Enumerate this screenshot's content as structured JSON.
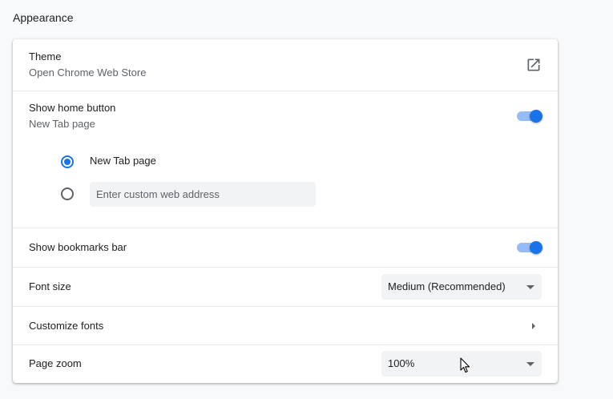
{
  "section": {
    "title": "Appearance"
  },
  "theme": {
    "label": "Theme",
    "sublabel": "Open Chrome Web Store",
    "icon": "open-in-new-icon"
  },
  "home_button": {
    "label": "Show home button",
    "sublabel": "New Tab page",
    "enabled": true,
    "options": [
      {
        "label": "New Tab page",
        "selected": true
      },
      {
        "label": "",
        "placeholder": "Enter custom web address",
        "selected": false
      }
    ]
  },
  "bookmarks_bar": {
    "label": "Show bookmarks bar",
    "enabled": true
  },
  "font_size": {
    "label": "Font size",
    "selected": "Medium (Recommended)"
  },
  "customize_fonts": {
    "label": "Customize fonts",
    "icon": "chevron-right-icon"
  },
  "page_zoom": {
    "label": "Page zoom",
    "selected": "100%"
  },
  "colors": {
    "accent": "#1a73e8",
    "toggle_track": "#8ab4f8",
    "card_bg": "#ffffff",
    "page_bg": "#f8f9fa"
  }
}
